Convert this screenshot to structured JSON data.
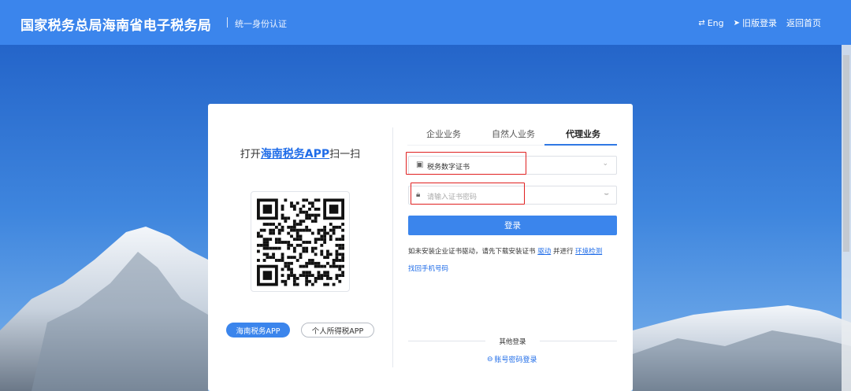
{
  "header": {
    "title": "国家税务总局海南省电子税务局",
    "subtitle": "统一身份认证",
    "links": [
      {
        "icon": "translate-icon",
        "label": "Eng"
      },
      {
        "icon": "send-icon",
        "label": "旧版登录"
      },
      {
        "label": "返回首页"
      }
    ]
  },
  "scan": {
    "prefix": "打开",
    "app_name": "海南税务APP",
    "suffix": "扫一扫",
    "buttons": [
      "海南税务APP",
      "个人所得税APP"
    ]
  },
  "tabs": [
    {
      "label": "企业业务",
      "active": false
    },
    {
      "label": "自然人业务",
      "active": false
    },
    {
      "label": "代理业务",
      "active": true
    }
  ],
  "form": {
    "cert_select_value": "税务数字证书",
    "cert_icon": "id-card-icon",
    "password_placeholder": "请输入证书密码",
    "password_icon": "lock-icon",
    "login_label": "登录",
    "note_text": "如未安装企业证书驱动，请先下载安装证书",
    "note_link_driver": "驱动",
    "note_mid": "并进行",
    "note_link_env": "环境检测",
    "find_phone": "找回手机号码",
    "other_login": "其他登录",
    "account_login": "账号密码登录"
  },
  "colors": {
    "header_bg": "#3b85ec",
    "primary": "#3b85ec",
    "link": "#1f6ce8",
    "highlight_box": "#e02020"
  }
}
